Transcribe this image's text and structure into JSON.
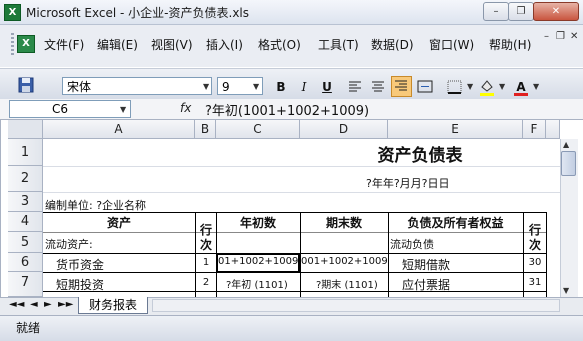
{
  "window": {
    "title": "Microsoft Excel - 小企业-资产负债表.xls",
    "app_icon": "X",
    "buttons": {
      "minimize": "–",
      "restore": "❐",
      "close": "✕"
    }
  },
  "menu": {
    "items": [
      "文件(F)",
      "编辑(E)",
      "视图(V)",
      "插入(I)",
      "格式(O)",
      "工具(T)",
      "数据(D)",
      "窗口(W)",
      "帮助(H)"
    ],
    "doc_controls": {
      "minimize": "–",
      "restore": "❐",
      "close": "✕"
    }
  },
  "toolbar": {
    "font_name": "宋体",
    "font_size": "9",
    "bold": "B",
    "italic": "I",
    "underline": "U",
    "font_color_hex": "#e02020",
    "fill_color_hex": "#ffff00"
  },
  "formula_bar": {
    "cell_ref": "C6",
    "fx": "fx",
    "formula": "?年初(1001+1002+1009)"
  },
  "columns": [
    "A",
    "B",
    "C",
    "D",
    "E",
    "F"
  ],
  "rows": [
    "1",
    "2",
    "3",
    "4",
    "5",
    "6",
    "7"
  ],
  "sheet": {
    "title": "资产负债表",
    "date_line": "?年年?月月?日日",
    "unit_line": "编制单位: ?企业名称",
    "headers": {
      "asset": "资产",
      "line_no_1": "行",
      "line_no_2": "次",
      "begin": "年初数",
      "end": "期末数",
      "liab": "负债及所有者权益",
      "line_no_f1": "行",
      "line_no_f2": "次"
    },
    "row5": {
      "a": "流动资产:",
      "e": "流动负债"
    },
    "row6": {
      "a": "货币资金",
      "b": "1",
      "c": "01+1002+1009)",
      "d": "001+1002+1009)",
      "e": "短期借款",
      "f": "30"
    },
    "row7": {
      "a": "短期投资",
      "b": "2",
      "c": "?年初 (1101)",
      "d": "?期末 (1101)",
      "e": "应付票据",
      "f": "31"
    }
  },
  "tabs": {
    "nav": [
      "◄◄",
      "◄",
      "►",
      "►►"
    ],
    "sheet_name": "财务报表"
  },
  "status": {
    "text": "就绪"
  }
}
